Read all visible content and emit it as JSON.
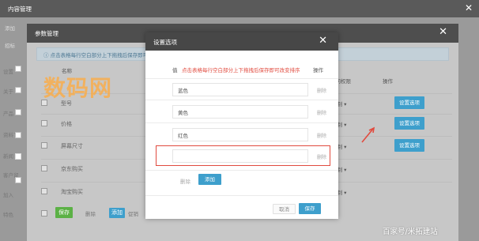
{
  "window": {
    "title": "内容管理",
    "close_glyph": "✕"
  },
  "bg_strip": [
    "添加",
    "招标"
  ],
  "param": {
    "title": "参数管理",
    "close_glyph": "✕",
    "info": "点击表格每行空白部分上下拖拽后保存即可改变排序",
    "side_labels": [
      "设置",
      "关于",
      "产品",
      "资料下",
      "新闻",
      "客户留",
      "加入",
      "特色"
    ],
    "header_name": "名称",
    "header_perm": "访问权限",
    "header_op": "操作",
    "rows": [
      {
        "name": "型号",
        "perm": "限制",
        "op": "设置选项"
      },
      {
        "name": "价格",
        "perm": "限制",
        "op": "设置选项"
      },
      {
        "name": "屏幕尺寸",
        "perm": "限制",
        "op": "设置选项"
      },
      {
        "name": "京东购买",
        "perm": "限制",
        "op": ""
      },
      {
        "name": "淘宝购买",
        "perm": "限制",
        "op": ""
      }
    ],
    "footer": {
      "save": "保存",
      "delete": "删除",
      "add": "添加",
      "more": "促销"
    }
  },
  "watermark": "数码网",
  "settings": {
    "title": "设置选项",
    "close_glyph": "✕",
    "header_value": "值",
    "hint": "点击表格每行空白部分上下拖拽后保存即可改变排序",
    "header_op": "操作",
    "items": [
      {
        "value": "蓝色",
        "delete": "删除"
      },
      {
        "value": "黄色",
        "delete": "删除"
      },
      {
        "value": "红色",
        "delete": "删除"
      },
      {
        "value": "",
        "delete": "删除"
      }
    ],
    "footer_delete": "删除",
    "footer_add": "添加",
    "cancel": "取消",
    "save": "保存"
  },
  "caption": "百家号/米拓建站",
  "colors": {
    "accent_blue": "#3e9fcc",
    "green": "#5cb146",
    "highlight": "#e14b3f",
    "hint_red": "#e14b3f"
  }
}
